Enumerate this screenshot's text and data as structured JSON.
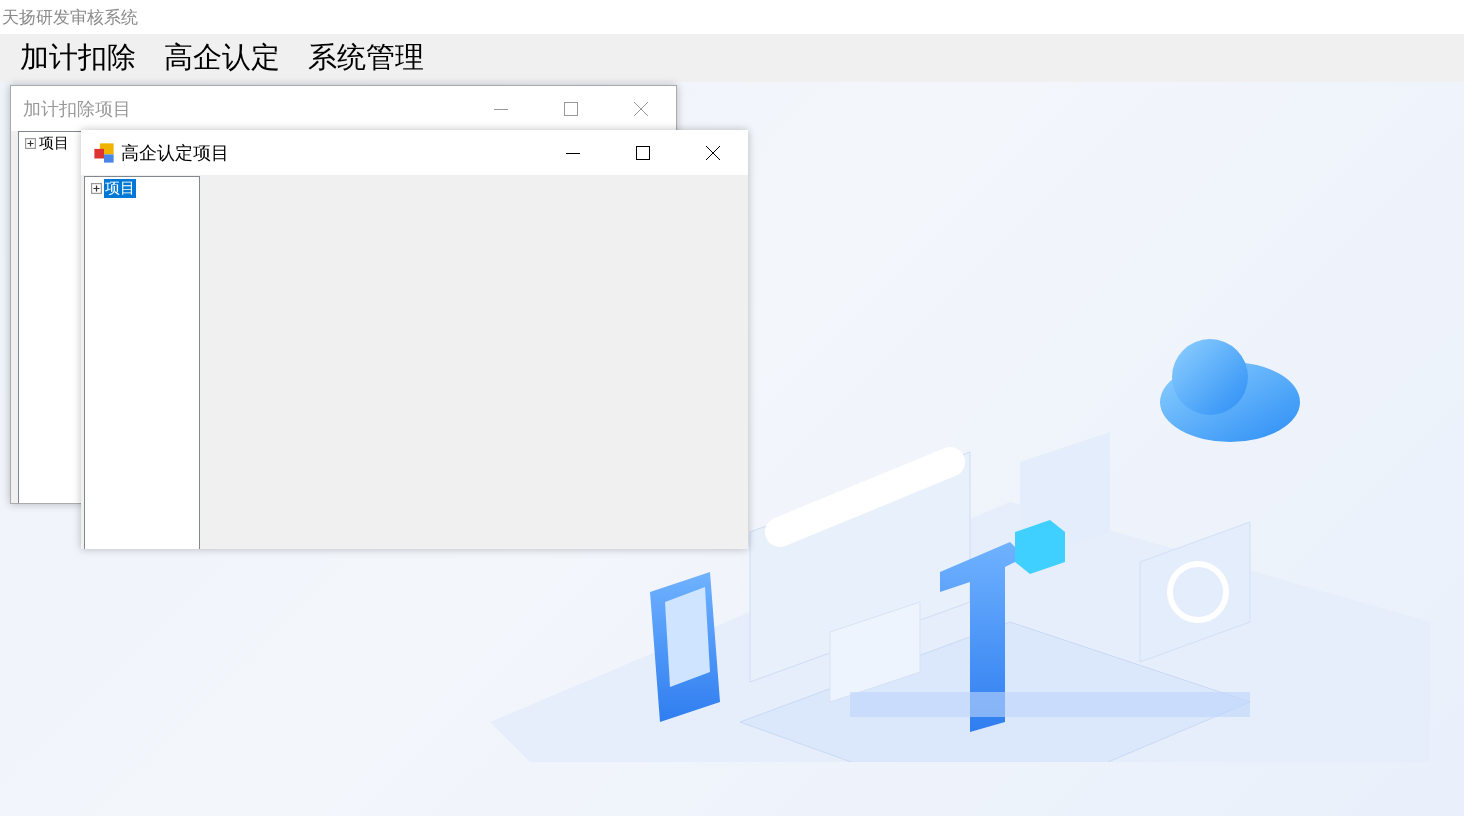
{
  "window": {
    "title": "天扬研发审核系统"
  },
  "menu": [
    {
      "label": "加计扣除"
    },
    {
      "label": "高企认定"
    },
    {
      "label": "系统管理"
    }
  ],
  "child_windows": [
    {
      "title": "加计扣除项目",
      "active": false,
      "icon": false,
      "tree": [
        {
          "label": "项目",
          "selected": false,
          "expanded": false
        }
      ]
    },
    {
      "title": "高企认定项目",
      "active": true,
      "icon": true,
      "tree": [
        {
          "label": "项目",
          "selected": true,
          "expanded": false
        }
      ]
    }
  ]
}
